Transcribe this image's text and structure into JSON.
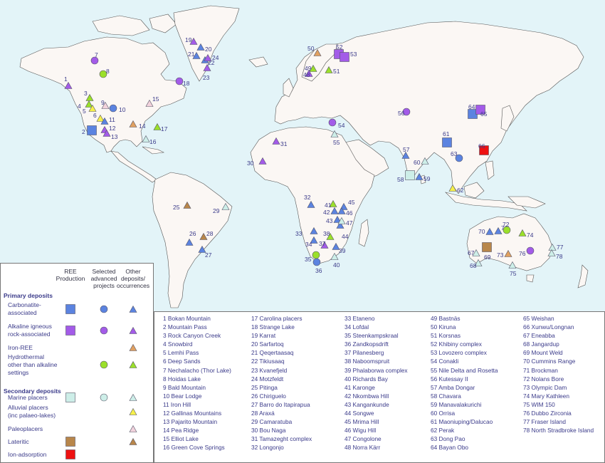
{
  "legend": {
    "col_headers": [
      "REE\nProduction",
      "Selected\nadvanced\nprojects",
      "Other\ndeposits/\noccurrences"
    ],
    "primary_title": "Primary deposits",
    "secondary_title": "Secondary deposits",
    "rows": [
      {
        "label": "Carbonatite-\nassociated",
        "color": "#5b83e0",
        "cells": [
          "square",
          "circle",
          "triangle"
        ]
      },
      {
        "label": "Alkaline igneous\nrock-associated",
        "color": "#a35be8",
        "cells": [
          "square",
          "circle",
          "triangle"
        ]
      },
      {
        "label": "Iron-REE",
        "color": "#e0a060",
        "cells": [
          "",
          "",
          "triangle"
        ]
      },
      {
        "label": "Hydrothermal\nother than alkaline\nsettings",
        "color": "#9be02a",
        "cells": [
          "",
          "circle",
          "triangle"
        ]
      },
      {
        "label": "Marine placers",
        "color": "#cdeee8",
        "cells": [
          "square",
          "circle",
          "triangle"
        ]
      },
      {
        "label": "Alluvial placers\n(inc palaeo-lakes)",
        "color": "#f6f04a",
        "cells": [
          "",
          "",
          "triangle"
        ]
      },
      {
        "label": "Paleoplacers",
        "color": "#f2d2dc",
        "cells": [
          "",
          "",
          "triangle"
        ]
      },
      {
        "label": "Lateritic",
        "color": "#b8864a",
        "cells": [
          "square",
          "",
          "triangle"
        ]
      },
      {
        "label": "Ion-adsorption",
        "color": "#ee1111",
        "cells": [
          "square",
          "",
          ""
        ]
      }
    ]
  },
  "sites": [
    "1 Bokan Mountain",
    "2 Mountain Pass",
    "3 Rock Canyon Creek",
    "4 Snowbird",
    "5 Lemhi Pass",
    "6 Deep Sands",
    "7 Nechalacho (Thor Lake)",
    "8 Hoidas Lake",
    "9 Bald Mountain",
    "10 Bear Lodge",
    "11 Iron Hill",
    "12 Gallinas Mountains",
    "13 Pajarito Mountain",
    "14 Pea Ridge",
    "15 Elliot Lake",
    "16 Green Cove Springs",
    "17 Carolina placers",
    "18 Strange Lake",
    "19 Karrat",
    "20 Sarfartoq",
    "21 Qeqertaasaq",
    "22 Tikiusaaq",
    "23 Kvanefjeld",
    "24 Motzfeldt",
    "25 Pitinga",
    "26 Chiriguelo",
    "27 Barro do Itapirapua",
    "28 Araxá",
    "29 Camaratuba",
    "30 Bou Naga",
    "31 Tamazeght complex",
    "32 Longonjo",
    "33 Etaneno",
    "34 Lofdal",
    "35 Steenkampskraal",
    "36 Zandkopsdrift",
    "37 Pilanesberg",
    "38 Naboomspruit",
    "39 Phalaborwa complex",
    "40 Richards Bay",
    "41 Karonge",
    "42 Nkombwa Hill",
    "43 Kangankunde",
    "44 Songwe",
    "45 Mrima Hill",
    "46 Wigu Hill",
    "47 Congolone",
    "48 Norra Kärr",
    "49 Bastnäs",
    "50 Kiruna",
    "51 Korsnas",
    "52 Khibiny complex",
    "53 Lovozero complex",
    "54 Conakli",
    "55 Nile Delta and Rosetta",
    "56 Kutessay II",
    "57 Amba Dongar",
    "58 Chavara",
    "59 Manavalakurichi",
    "60 Orrisa",
    "61 Maoniuping/Dalucao",
    "62 Perak",
    "63 Dong Pao",
    "64 Bayan Obo",
    "65 Weishan",
    "66 Xunwu/Longnan",
    "67 Eneabba",
    "68 Jangardup",
    "69 Mount Weld",
    "70 Cummins Range",
    "71 Brockman",
    "72 Nolans Bore",
    "73 Olympic Dam",
    "74 Mary Kathleen",
    "75 WIM 150",
    "76 Dubbo Zirconia",
    "77 Fraser Island",
    "78 North Stradbroke Island"
  ],
  "markers": [
    {
      "n": "1",
      "s": "triangle",
      "c": "#a35be8"
    },
    {
      "n": "2",
      "s": "square",
      "c": "#5b83e0"
    },
    {
      "n": "3",
      "s": "triangle",
      "c": "#9be02a"
    },
    {
      "n": "4",
      "s": "triangle",
      "c": "#9be02a"
    },
    {
      "n": "5",
      "s": "triangle",
      "c": "#f6f04a"
    },
    {
      "n": "6",
      "s": "triangle",
      "c": "#f6f04a"
    },
    {
      "n": "7",
      "s": "circle",
      "c": "#a35be8"
    },
    {
      "n": "8",
      "s": "circle",
      "c": "#9be02a"
    },
    {
      "n": "9",
      "s": "triangle",
      "c": "#f2d2dc"
    },
    {
      "n": "10",
      "s": "circle",
      "c": "#5b83e0"
    },
    {
      "n": "11",
      "s": "triangle",
      "c": "#5b83e0"
    },
    {
      "n": "12",
      "s": "triangle",
      "c": "#a35be8"
    },
    {
      "n": "13",
      "s": "triangle",
      "c": "#a35be8"
    },
    {
      "n": "14",
      "s": "triangle",
      "c": "#e0a060"
    },
    {
      "n": "15",
      "s": "triangle",
      "c": "#f2d2dc"
    },
    {
      "n": "16",
      "s": "triangle",
      "c": "#cdeee8"
    },
    {
      "n": "17",
      "s": "triangle",
      "c": "#9be02a"
    },
    {
      "n": "18",
      "s": "circle",
      "c": "#a35be8"
    },
    {
      "n": "19",
      "s": "triangle",
      "c": "#a35be8"
    },
    {
      "n": "20",
      "s": "triangle",
      "c": "#5b83e0"
    },
    {
      "n": "21",
      "s": "triangle",
      "c": "#5b83e0"
    },
    {
      "n": "22",
      "s": "triangle",
      "c": "#5b83e0"
    },
    {
      "n": "23",
      "s": "triangle",
      "c": "#a35be8"
    },
    {
      "n": "24",
      "s": "triangle",
      "c": "#a35be8"
    },
    {
      "n": "25",
      "s": "triangle",
      "c": "#b8864a"
    },
    {
      "n": "26",
      "s": "triangle",
      "c": "#5b83e0"
    },
    {
      "n": "27",
      "s": "triangle",
      "c": "#5b83e0"
    },
    {
      "n": "28",
      "s": "triangle",
      "c": "#b8864a"
    },
    {
      "n": "29",
      "s": "triangle",
      "c": "#cdeee8"
    },
    {
      "n": "30",
      "s": "triangle",
      "c": "#a35be8"
    },
    {
      "n": "31",
      "s": "triangle",
      "c": "#a35be8"
    },
    {
      "n": "32",
      "s": "triangle",
      "c": "#5b83e0"
    },
    {
      "n": "33",
      "s": "triangle",
      "c": "#5b83e0"
    },
    {
      "n": "34",
      "s": "triangle",
      "c": "#5b83e0"
    },
    {
      "n": "35",
      "s": "circle",
      "c": "#9be02a"
    },
    {
      "n": "36",
      "s": "circle",
      "c": "#5b83e0"
    },
    {
      "n": "37",
      "s": "triangle",
      "c": "#a35be8"
    },
    {
      "n": "38",
      "s": "triangle",
      "c": "#9be02a"
    },
    {
      "n": "39",
      "s": "triangle",
      "c": "#5b83e0"
    },
    {
      "n": "40",
      "s": "triangle",
      "c": "#cdeee8"
    },
    {
      "n": "41",
      "s": "triangle",
      "c": "#9be02a"
    },
    {
      "n": "42",
      "s": "triangle",
      "c": "#5b83e0"
    },
    {
      "n": "43",
      "s": "triangle",
      "c": "#5b83e0"
    },
    {
      "n": "44",
      "s": "triangle",
      "c": "#5b83e0"
    },
    {
      "n": "45",
      "s": "triangle",
      "c": "#5b83e0"
    },
    {
      "n": "46",
      "s": "triangle",
      "c": "#5b83e0"
    },
    {
      "n": "47",
      "s": "triangle",
      "c": "#cdeee8"
    },
    {
      "n": "48",
      "s": "triangle",
      "c": "#a35be8"
    },
    {
      "n": "49",
      "s": "triangle",
      "c": "#9be02a"
    },
    {
      "n": "50",
      "s": "triangle",
      "c": "#e0a060"
    },
    {
      "n": "51",
      "s": "triangle",
      "c": "#9be02a"
    },
    {
      "n": "52",
      "s": "square",
      "c": "#a35be8"
    },
    {
      "n": "53",
      "s": "square",
      "c": "#a35be8"
    },
    {
      "n": "54",
      "s": "circle",
      "c": "#a35be8"
    },
    {
      "n": "55",
      "s": "triangle",
      "c": "#cdeee8"
    },
    {
      "n": "56",
      "s": "circle",
      "c": "#a35be8"
    },
    {
      "n": "57",
      "s": "triangle",
      "c": "#5b83e0"
    },
    {
      "n": "58",
      "s": "square",
      "c": "#cdeee8"
    },
    {
      "n": "59",
      "s": "triangle",
      "c": "#5b83e0"
    },
    {
      "n": "60",
      "s": "triangle",
      "c": "#cdeee8"
    },
    {
      "n": "61",
      "s": "square",
      "c": "#5b83e0"
    },
    {
      "n": "62",
      "s": "triangle",
      "c": "#f6f04a"
    },
    {
      "n": "63",
      "s": "circle",
      "c": "#5b83e0"
    },
    {
      "n": "64",
      "s": "square",
      "c": "#5b83e0"
    },
    {
      "n": "65",
      "s": "square",
      "c": "#a35be8"
    },
    {
      "n": "66",
      "s": "square",
      "c": "#ee1111"
    },
    {
      "n": "67",
      "s": "triangle",
      "c": "#cdeee8"
    },
    {
      "n": "68",
      "s": "triangle",
      "c": "#cdeee8"
    },
    {
      "n": "69",
      "s": "square",
      "c": "#b8864a"
    },
    {
      "n": "70",
      "s": "triangle",
      "c": "#5b83e0"
    },
    {
      "n": "71",
      "s": "triangle",
      "c": "#5b83e0"
    },
    {
      "n": "72",
      "s": "circle",
      "c": "#9be02a"
    },
    {
      "n": "73",
      "s": "triangle",
      "c": "#e0a060"
    },
    {
      "n": "74",
      "s": "triangle",
      "c": "#9be02a"
    },
    {
      "n": "75",
      "s": "triangle",
      "c": "#cdeee8"
    },
    {
      "n": "76",
      "s": "circle",
      "c": "#a35be8"
    },
    {
      "n": "77",
      "s": "triangle",
      "c": "#cdeee8"
    },
    {
      "n": "78",
      "s": "triangle",
      "c": "#cdeee8"
    }
  ]
}
